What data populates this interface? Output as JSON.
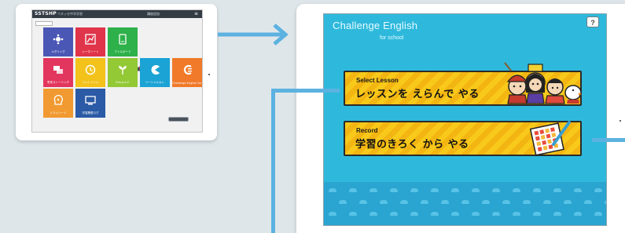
{
  "left_tablet": {
    "header": {
      "logo": "SSTSHP",
      "subtitle": "ベネッセ中学学習",
      "center_text": "講座追加",
      "menu_icon": "hamburger-icon"
    },
    "tiles": [
      {
        "color": "#4b57b5",
        "label": "メダリング",
        "icon": "hub-icon"
      },
      {
        "color": "#e0344a",
        "label": "レーダノート",
        "icon": "chart-icon"
      },
      {
        "color": "#2eb14a",
        "label": "アトルボード",
        "icon": "tablet-icon"
      },
      {
        "color": "#e2365e",
        "label": "思考ストーリング",
        "icon": "chat-icon"
      },
      {
        "color": "#f3c21b",
        "label": "コントドリル",
        "icon": "clock-icon"
      },
      {
        "color": "#93c934",
        "label": "Eduカルテ",
        "icon": "sprout-icon"
      },
      {
        "color": "#1aa3d4",
        "label": "ソーシャルカレ",
        "icon": "packman-icon"
      },
      {
        "color": "#f07a2a",
        "label": "Challenge English for school",
        "icon": "ce-logo-icon"
      },
      {
        "color": "#f19a32",
        "label": "ミライシード",
        "icon": "head-icon"
      },
      {
        "color": "#2b5aa6",
        "label": "学習履歴ログ",
        "icon": "pc-icon"
      }
    ]
  },
  "right_tablet": {
    "title": "Challenge English",
    "subtitle": "for school",
    "help_label": "?",
    "buttons": [
      {
        "en": "Select Lesson",
        "ja": "レッスンを えらんで やる"
      },
      {
        "en": "Record",
        "ja": "学習のきろく から やる"
      }
    ]
  },
  "colors": {
    "background": "#dfe6ea",
    "screen_blue": "#2eb9dc",
    "button_yellow": "#f8c91a",
    "arrow_blue": "#5cb2e0"
  }
}
